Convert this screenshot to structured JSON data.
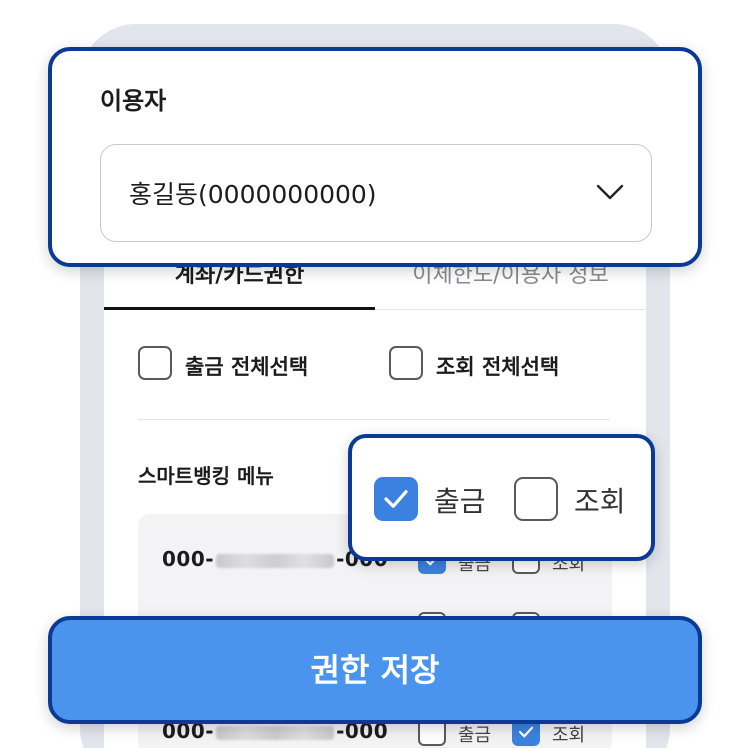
{
  "user": {
    "label": "이용자",
    "selected": "홍길동(0000000000)"
  },
  "tabs": [
    {
      "label": "계좌/카드권한",
      "active": true
    },
    {
      "label": "이체한도/이용자 정보",
      "active": false
    }
  ],
  "select_all": {
    "withdraw_label": "출금 전체선택",
    "withdraw_checked": false,
    "inquiry_label": "조회 전체선택",
    "inquiry_checked": false
  },
  "section_title": "스마트뱅킹 메뉴",
  "accounts": [
    {
      "prefix": "000-",
      "suffix": "-000",
      "withdraw": true,
      "inquiry": false
    },
    {
      "prefix": "",
      "suffix": "",
      "withdraw": false,
      "inquiry": false
    },
    {
      "prefix": "000-",
      "suffix": "-000",
      "withdraw": false,
      "inquiry": true
    }
  ],
  "permission_labels": {
    "withdraw": "출금",
    "inquiry": "조회"
  },
  "popup": {
    "withdraw_checked": true,
    "inquiry_checked": false
  },
  "save_button": "권한 저장",
  "colors": {
    "accent": "#4a94ee",
    "outline": "#0b3a96",
    "check": "#3b82e0"
  }
}
